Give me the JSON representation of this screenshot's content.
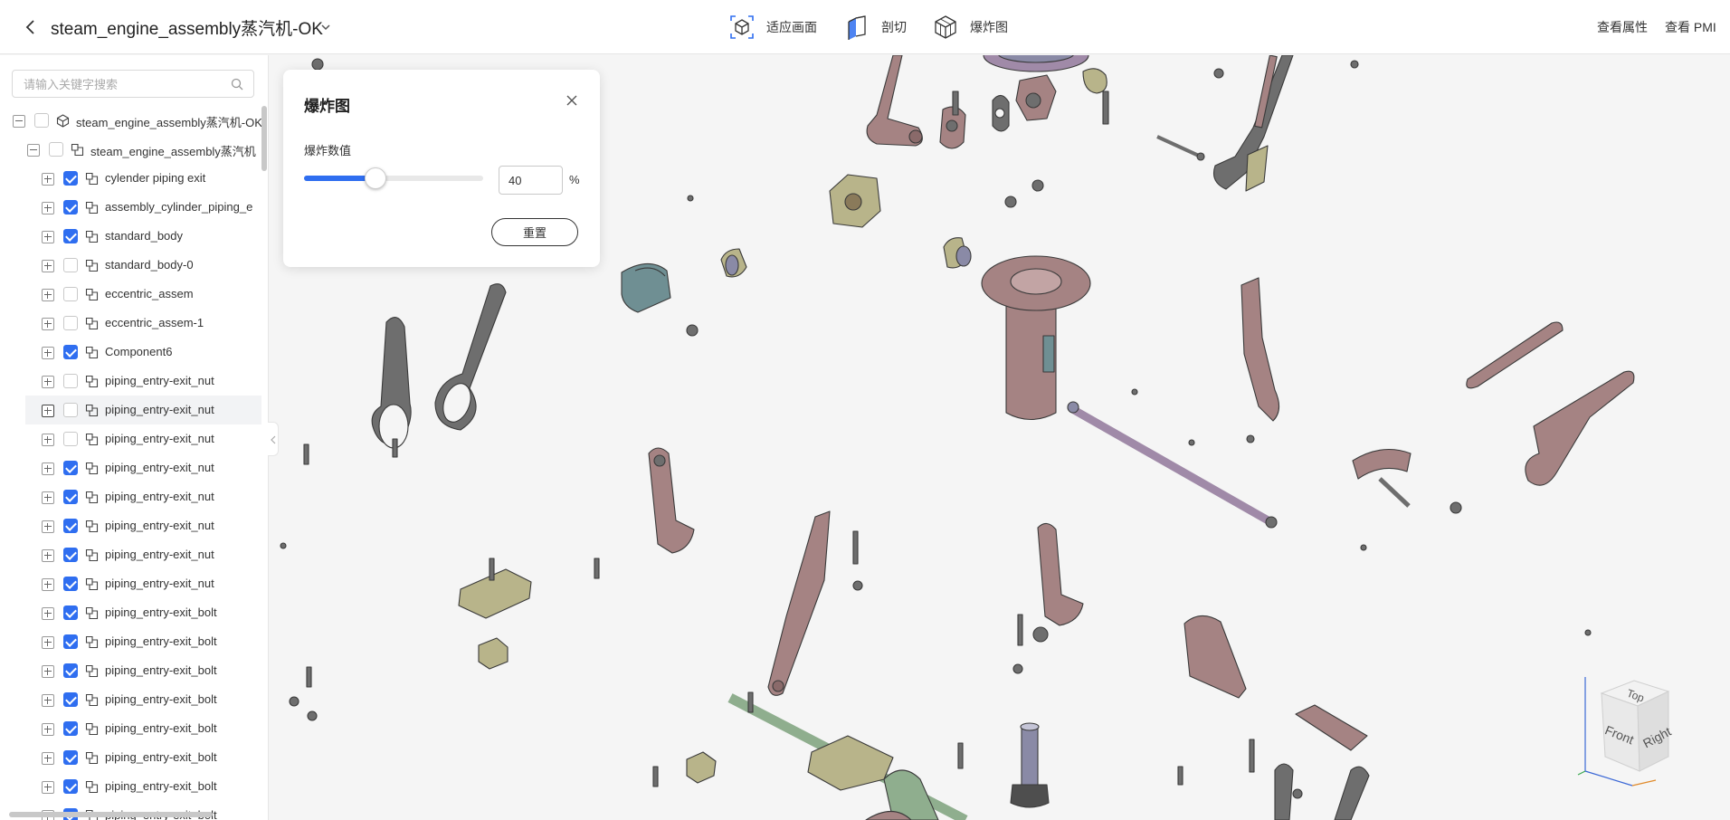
{
  "header": {
    "title": "steam_engine_assembly蒸汽机-OK",
    "tools": {
      "fit": "适应画面",
      "section": "剖切",
      "explode": "爆炸图"
    },
    "links": {
      "properties": "查看属性",
      "pmi": "查看 PMI"
    }
  },
  "sidebar": {
    "search_placeholder": "请输入关键字搜索",
    "tree": [
      {
        "label": "steam_engine_assembly蒸汽机-OK",
        "level": 0,
        "expanded": true,
        "check": "partial",
        "icon": "assembly-icon"
      },
      {
        "label": "steam_engine_assembly蒸汽机",
        "level": 1,
        "expanded": true,
        "check": "partial",
        "icon": "part-icon"
      },
      {
        "label": "cylender piping exit",
        "level": 2,
        "check": "on",
        "icon": "part-icon"
      },
      {
        "label": "assembly_cylinder_piping_e",
        "level": 2,
        "check": "on",
        "icon": "part-icon"
      },
      {
        "label": "standard_body",
        "level": 2,
        "check": "on",
        "icon": "part-icon"
      },
      {
        "label": "standard_body-0",
        "level": 2,
        "check": "off",
        "icon": "part-icon"
      },
      {
        "label": "eccentric_assem",
        "level": 2,
        "check": "off",
        "icon": "part-icon"
      },
      {
        "label": "eccentric_assem-1",
        "level": 2,
        "check": "off",
        "icon": "part-icon"
      },
      {
        "label": "Component6",
        "level": 2,
        "check": "on",
        "icon": "part-icon"
      },
      {
        "label": "piping_entry-exit_nut",
        "level": 2,
        "check": "off",
        "icon": "part-icon"
      },
      {
        "label": "piping_entry-exit_nut",
        "level": 2,
        "check": "off",
        "icon": "part-icon",
        "hover": true
      },
      {
        "label": "piping_entry-exit_nut",
        "level": 2,
        "check": "off",
        "icon": "part-icon"
      },
      {
        "label": "piping_entry-exit_nut",
        "level": 2,
        "check": "on",
        "icon": "part-icon"
      },
      {
        "label": "piping_entry-exit_nut",
        "level": 2,
        "check": "on",
        "icon": "part-icon"
      },
      {
        "label": "piping_entry-exit_nut",
        "level": 2,
        "check": "on",
        "icon": "part-icon"
      },
      {
        "label": "piping_entry-exit_nut",
        "level": 2,
        "check": "on",
        "icon": "part-icon"
      },
      {
        "label": "piping_entry-exit_nut",
        "level": 2,
        "check": "on",
        "icon": "part-icon"
      },
      {
        "label": "piping_entry-exit_bolt",
        "level": 2,
        "check": "on",
        "icon": "part-icon"
      },
      {
        "label": "piping_entry-exit_bolt",
        "level": 2,
        "check": "on",
        "icon": "part-icon"
      },
      {
        "label": "piping_entry-exit_bolt",
        "level": 2,
        "check": "on",
        "icon": "part-icon"
      },
      {
        "label": "piping_entry-exit_bolt",
        "level": 2,
        "check": "on",
        "icon": "part-icon"
      },
      {
        "label": "piping_entry-exit_bolt",
        "level": 2,
        "check": "on",
        "icon": "part-icon"
      },
      {
        "label": "piping_entry-exit_bolt",
        "level": 2,
        "check": "on",
        "icon": "part-icon"
      },
      {
        "label": "piping_entry-exit_bolt",
        "level": 2,
        "check": "on",
        "icon": "part-icon"
      },
      {
        "label": "piping_entry-exit_bolt",
        "level": 2,
        "check": "on",
        "icon": "part-icon"
      }
    ]
  },
  "explode_dialog": {
    "title": "爆炸图",
    "value_label": "爆炸数值",
    "value": "40",
    "fraction": 0.4,
    "unit": "%",
    "reset_label": "重置"
  },
  "viewcube": {
    "top": "Top",
    "front": "Front",
    "right": "Right"
  },
  "colors": {
    "accent": "#2f6ef0",
    "part_mauve": "#a58383",
    "part_grey": "#6e6e6e",
    "part_olive": "#b8b48a",
    "part_green": "#8fae8e",
    "part_teal": "#6f8f93",
    "part_steel": "#8a8aa6",
    "part_lilac": "#a08aa8"
  }
}
